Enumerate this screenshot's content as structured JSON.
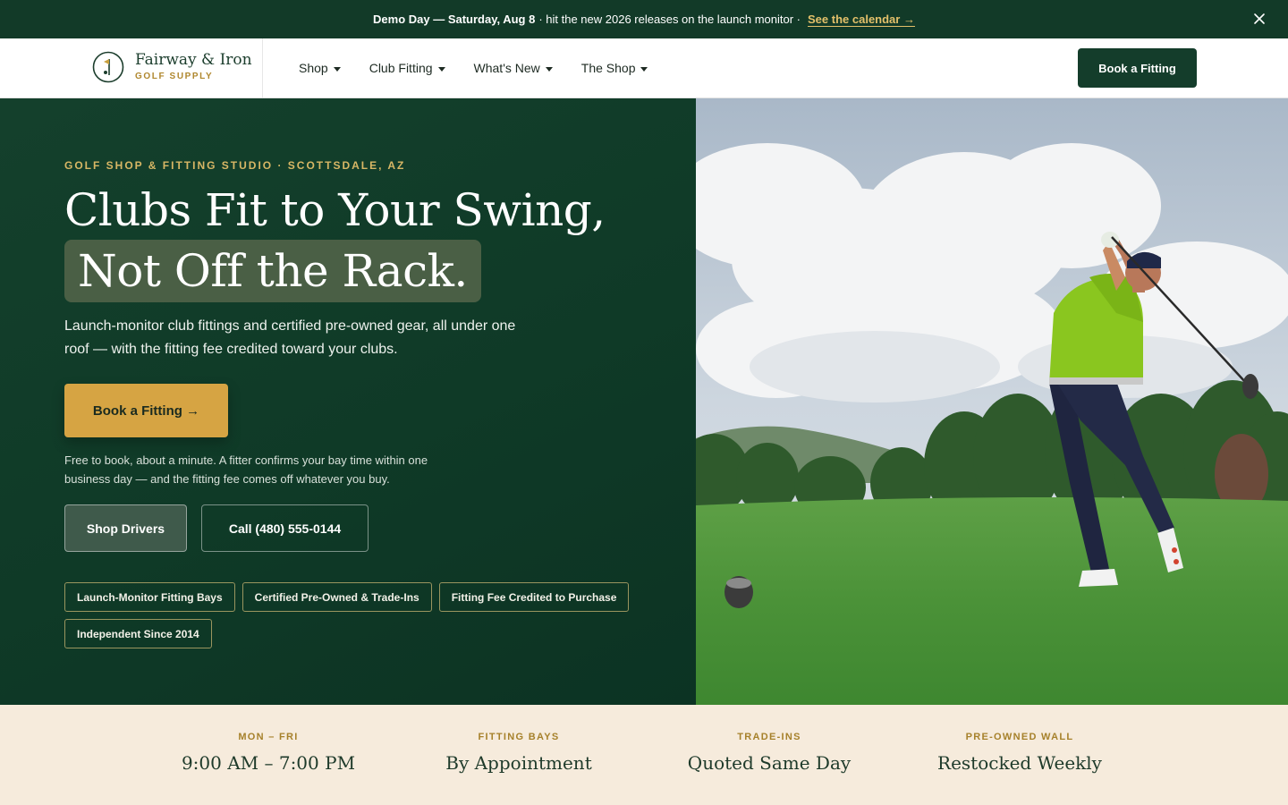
{
  "announcement": {
    "strong": "Demo Day — Saturday, Aug 8",
    "rest": "· hit the new 2026 releases on the launch monitor ·",
    "link": "See the calendar →"
  },
  "brand": {
    "name": "Fairway & Iron",
    "sub": "GOLF SUPPLY"
  },
  "nav": {
    "items": [
      {
        "label": "Shop"
      },
      {
        "label": "Club Fitting"
      },
      {
        "label": "What's New"
      },
      {
        "label": "The Shop"
      }
    ],
    "cta": "Book a Fitting"
  },
  "hero": {
    "eyebrow": "GOLF SHOP & FITTING STUDIO · SCOTTSDALE, AZ",
    "title_line1": "Clubs Fit to Your Swing,",
    "title_line2": "Not Off the Rack.",
    "lead": "Launch-monitor club fittings and certified pre-owned gear, all under one roof — with the fitting fee credited toward your clubs.",
    "cta": "Book a Fitting →",
    "fine_print": "Free to book, about a minute. A fitter confirms your bay time within one business day — and the fitting fee comes off whatever you buy.",
    "secondary_button": "Shop Drivers",
    "call_button": "Call (480) 555-0144",
    "chips": [
      "Launch-Monitor Fitting Bays",
      "Certified Pre-Owned & Trade-Ins",
      "Fitting Fee Credited to Purchase",
      "Independent Since 2014"
    ]
  },
  "stats": [
    {
      "label": "MON – FRI",
      "value": "9:00 AM – 7:00 PM"
    },
    {
      "label": "FITTING BAYS",
      "value": "By Appointment"
    },
    {
      "label": "TRADE-INS",
      "value": "Quoted Same Day"
    },
    {
      "label": "PRE-OWNED WALL",
      "value": "Restocked Weekly"
    }
  ],
  "colors": {
    "primary_green": "#123a28",
    "gold_accent": "#d6a443",
    "cream": "#f6ebdc"
  }
}
